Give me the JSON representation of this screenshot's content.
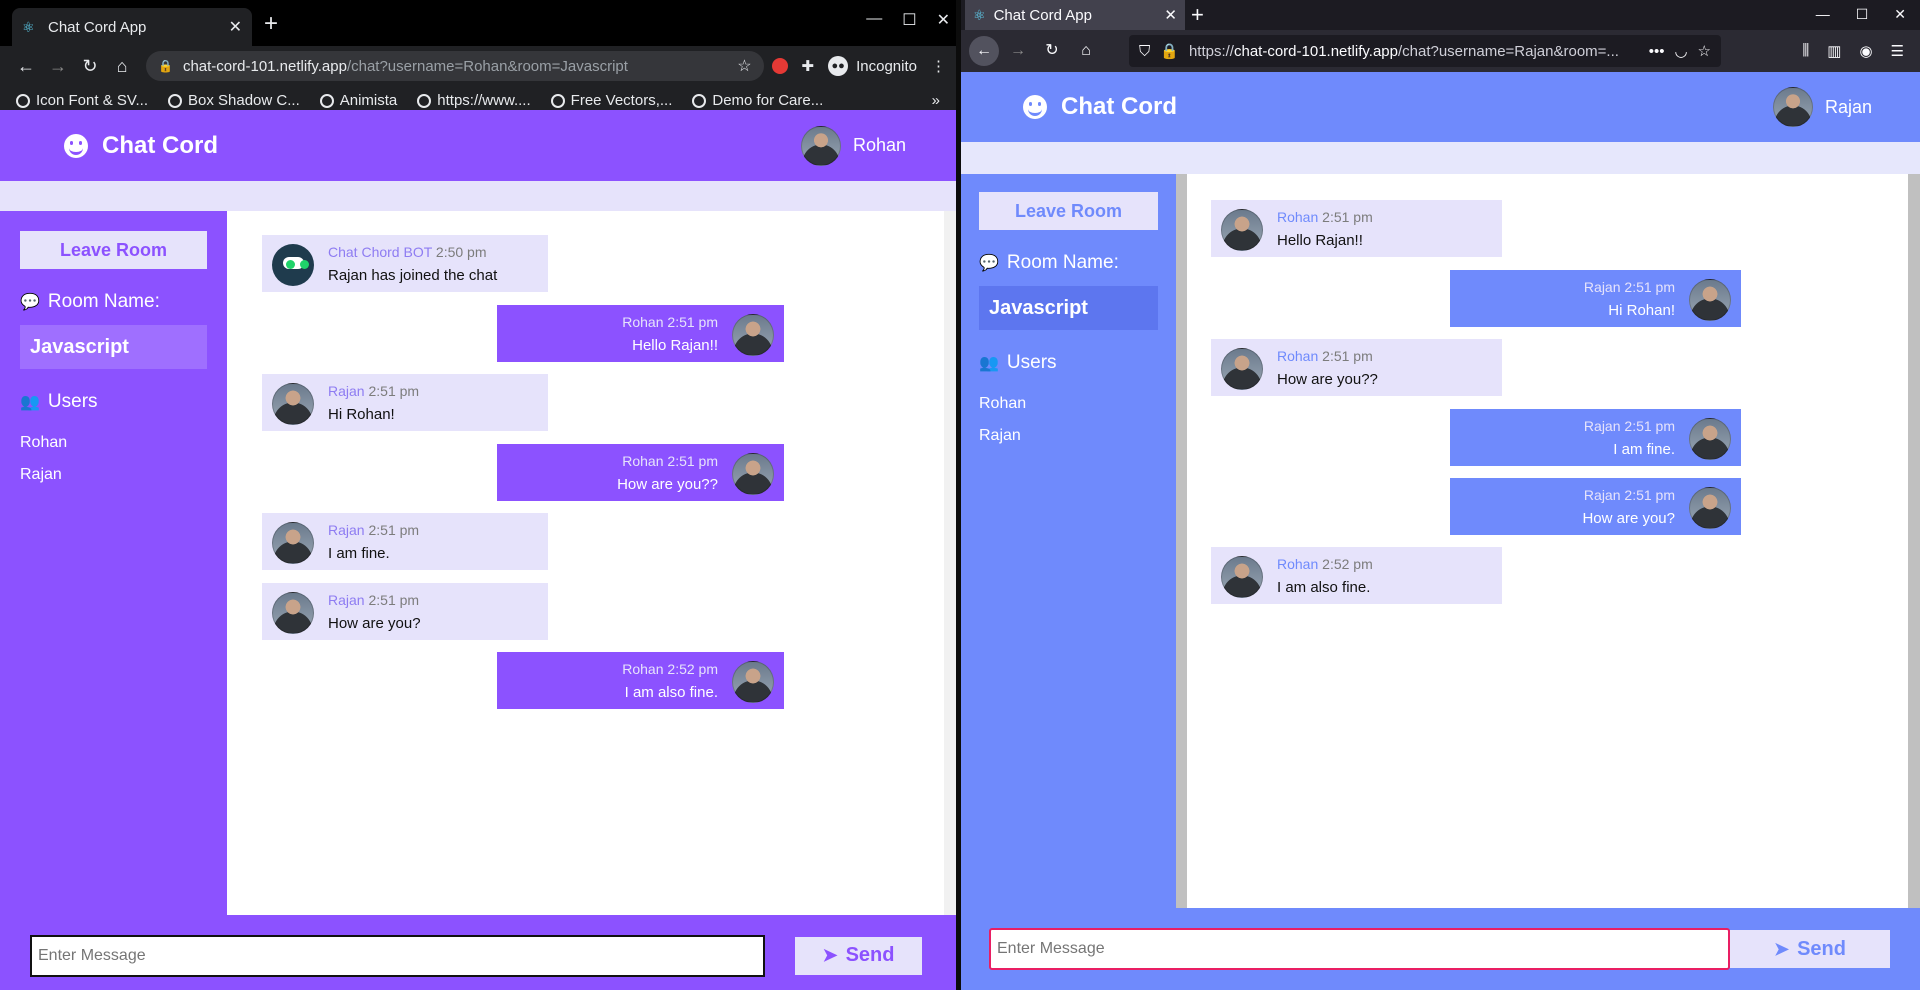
{
  "left_browser": {
    "tab_title": "Chat Cord App",
    "url_host": "chat-cord-101.netlify.app",
    "url_path": "/chat?username=Rohan&room=Javascript",
    "incognito_label": "Incognito",
    "bookmarks": [
      "Icon Font & SV...",
      "Box Shadow C...",
      "Animista",
      "https://www....",
      "Free Vectors,...",
      "Demo for Care..."
    ]
  },
  "right_browser": {
    "tab_title": "Chat Cord App",
    "url_prefix": "https://",
    "url_host": "chat-cord-101.netlify.app",
    "url_path": "/chat?username=Rajan&room=..."
  },
  "left_app": {
    "brand": "Chat Cord",
    "current_user": "Rohan",
    "leave_label": "Leave Room",
    "room_heading": "Room Name:",
    "room_name": "Javascript",
    "users_heading": "Users",
    "users": [
      "Rohan",
      "Rajan"
    ],
    "input_placeholder": "Enter Message",
    "send_label": "Send",
    "messages": [
      {
        "name": "Chat Chord BOT",
        "time": "2:50 pm",
        "text": "Rajan has joined the chat"
      },
      {
        "name": "Rohan",
        "time": "2:51 pm",
        "text": "Hello Rajan!!"
      },
      {
        "name": "Rajan",
        "time": "2:51 pm",
        "text": "Hi Rohan!"
      },
      {
        "name": "Rohan",
        "time": "2:51 pm",
        "text": "How are you??"
      },
      {
        "name": "Rajan",
        "time": "2:51 pm",
        "text": "I am fine."
      },
      {
        "name": "Rajan",
        "time": "2:51 pm",
        "text": "How are you?"
      },
      {
        "name": "Rohan",
        "time": "2:52 pm",
        "text": "I am also fine."
      }
    ]
  },
  "right_app": {
    "brand": "Chat Cord",
    "current_user": "Rajan",
    "leave_label": "Leave Room",
    "room_heading": "Room Name:",
    "room_name": "Javascript",
    "users_heading": "Users",
    "users": [
      "Rohan",
      "Rajan"
    ],
    "input_placeholder": "Enter Message",
    "send_label": "Send",
    "messages": [
      {
        "name": "Rohan",
        "time": "2:51 pm",
        "text": "Hello Rajan!!"
      },
      {
        "name": "Rajan",
        "time": "2:51 pm",
        "text": "Hi Rohan!"
      },
      {
        "name": "Rohan",
        "time": "2:51 pm",
        "text": "How are you??"
      },
      {
        "name": "Rajan",
        "time": "2:51 pm",
        "text": "I am fine."
      },
      {
        "name": "Rajan",
        "time": "2:51 pm",
        "text": "How are you?"
      },
      {
        "name": "Rohan",
        "time": "2:52 pm",
        "text": "I am also fine."
      }
    ]
  },
  "theme": {
    "left_accent": "#8c52ff",
    "right_accent": "#6f8afc",
    "bubble_light": "#e6e3fb"
  }
}
